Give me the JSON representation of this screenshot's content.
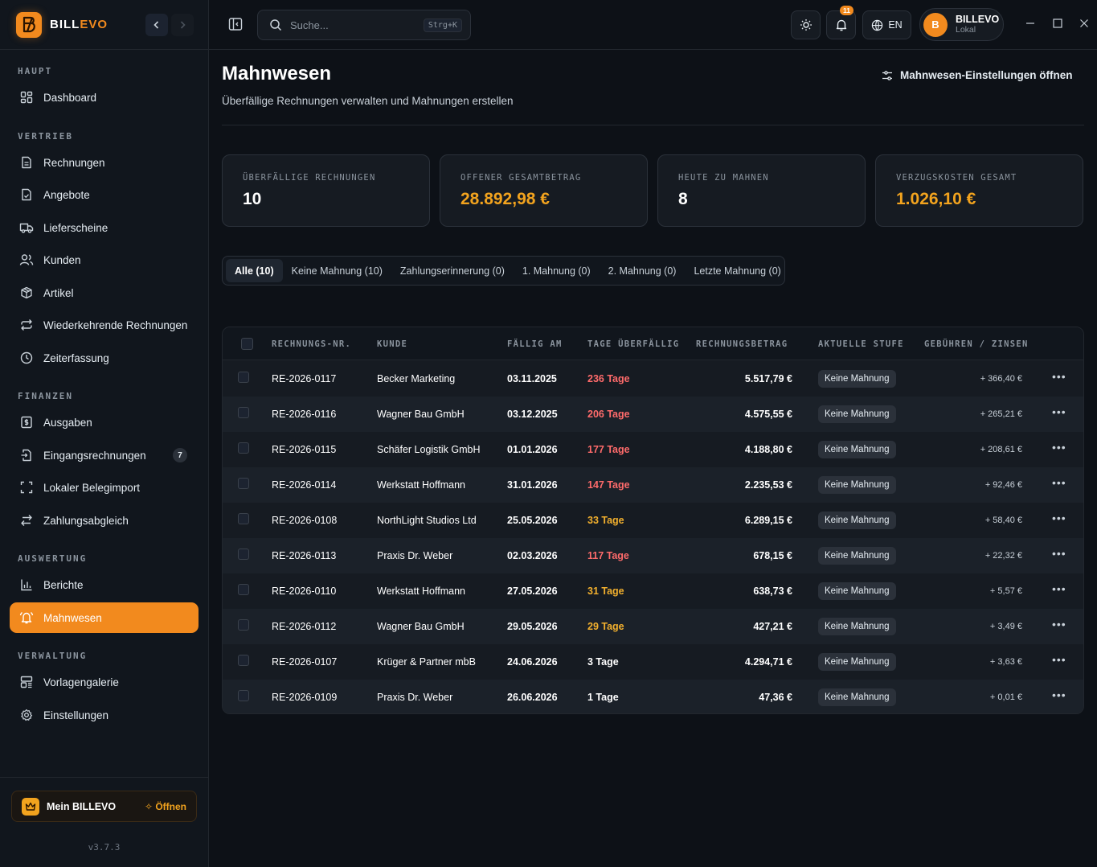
{
  "brand": {
    "name_part1": "BILL",
    "name_part2": "EVO"
  },
  "sidebar": {
    "sections": {
      "haupt": "HAUPT",
      "vertrieb": "VERTRIEB",
      "finanzen": "FINANZEN",
      "auswertung": "AUSWERTUNG",
      "verwaltung": "VERWALTUNG"
    },
    "items": {
      "dashboard": "Dashboard",
      "rechnungen": "Rechnungen",
      "angebote": "Angebote",
      "lieferscheine": "Lieferscheine",
      "kunden": "Kunden",
      "artikel": "Artikel",
      "wiederkehrend": "Wiederkehrende Rechnungen",
      "zeiterfassung": "Zeiterfassung",
      "ausgaben": "Ausgaben",
      "eingangsrechnungen": "Eingangsrechnungen",
      "eingangsrechnungen_count": "7",
      "belegimport": "Lokaler Belegimport",
      "zahlungsabgleich": "Zahlungsabgleich",
      "berichte": "Berichte",
      "mahnwesen": "Mahnwesen",
      "vorlagengalerie": "Vorlagengalerie",
      "einstellungen": "Einstellungen"
    },
    "mein": {
      "label": "Mein BILLEVO",
      "open": "Öffnen"
    },
    "version": "v3.7.3"
  },
  "header": {
    "search_placeholder": "Suche...",
    "search_shortcut": "Strg+K",
    "notifications_count": "11",
    "language": "EN",
    "user": {
      "initial": "B",
      "name": "BILLEVO",
      "sub": "Lokal"
    }
  },
  "page": {
    "title": "Mahnwesen",
    "subtitle": "Überfällige Rechnungen verwalten und Mahnungen erstellen",
    "settings_link": "Mahnwesen-Einstellungen öffnen"
  },
  "stats": [
    {
      "label": "ÜBERFÄLLIGE RECHNUNGEN",
      "value": "10"
    },
    {
      "label": "OFFENER GESAMTBETRAG",
      "value": "28.892,98 €"
    },
    {
      "label": "HEUTE ZU MAHNEN",
      "value": "8"
    },
    {
      "label": "VERZUGSKOSTEN GESAMT",
      "value": "1.026,10 €"
    }
  ],
  "tabs": [
    "Alle (10)",
    "Keine Mahnung (10)",
    "Zahlungserinnerung (0)",
    "1. Mahnung (0)",
    "2. Mahnung (0)",
    "Letzte Mahnung (0)"
  ],
  "table": {
    "headers": {
      "nr": "RECHNUNGS-NR.",
      "kunde": "KUNDE",
      "faellig": "FÄLLIG AM",
      "tage": "TAGE ÜBERFÄLLIG",
      "betrag": "RECHNUNGSBETRAG",
      "stufe": "AKTUELLE STUFE",
      "gebuehren": "GEBÜHREN / ZINSEN"
    },
    "rows": [
      {
        "nr": "RE-2026-0117",
        "kunde": "Becker Marketing",
        "faellig": "03.11.2025",
        "tage": "236 Tage",
        "betrag": "5.517,79 €",
        "stufe": "Keine Mahnung",
        "gebuehren": "+ 366,40 €"
      },
      {
        "nr": "RE-2026-0116",
        "kunde": "Wagner Bau GmbH",
        "faellig": "03.12.2025",
        "tage": "206 Tage",
        "betrag": "4.575,55 €",
        "stufe": "Keine Mahnung",
        "gebuehren": "+ 265,21 €"
      },
      {
        "nr": "RE-2026-0115",
        "kunde": "Schäfer Logistik GmbH",
        "faellig": "01.01.2026",
        "tage": "177 Tage",
        "betrag": "4.188,80 €",
        "stufe": "Keine Mahnung",
        "gebuehren": "+ 208,61 €"
      },
      {
        "nr": "RE-2026-0114",
        "kunde": "Werkstatt Hoffmann",
        "faellig": "31.01.2026",
        "tage": "147 Tage",
        "betrag": "2.235,53 €",
        "stufe": "Keine Mahnung",
        "gebuehren": "+ 92,46 €"
      },
      {
        "nr": "RE-2026-0108",
        "kunde": "NorthLight Studios Ltd",
        "faellig": "25.05.2026",
        "tage": "33 Tage",
        "betrag": "6.289,15 €",
        "stufe": "Keine Mahnung",
        "gebuehren": "+ 58,40 €"
      },
      {
        "nr": "RE-2026-0113",
        "kunde": "Praxis Dr. Weber",
        "faellig": "02.03.2026",
        "tage": "117 Tage",
        "betrag": "678,15 €",
        "stufe": "Keine Mahnung",
        "gebuehren": "+ 22,32 €"
      },
      {
        "nr": "RE-2026-0110",
        "kunde": "Werkstatt Hoffmann",
        "faellig": "27.05.2026",
        "tage": "31 Tage",
        "betrag": "638,73 €",
        "stufe": "Keine Mahnung",
        "gebuehren": "+ 5,57 €"
      },
      {
        "nr": "RE-2026-0112",
        "kunde": "Wagner Bau GmbH",
        "faellig": "29.05.2026",
        "tage": "29 Tage",
        "betrag": "427,21 €",
        "stufe": "Keine Mahnung",
        "gebuehren": "+ 3,49 €"
      },
      {
        "nr": "RE-2026-0107",
        "kunde": "Krüger & Partner mbB",
        "faellig": "24.06.2026",
        "tage": "3 Tage",
        "betrag": "4.294,71 €",
        "stufe": "Keine Mahnung",
        "gebuehren": "+ 3,63 €"
      },
      {
        "nr": "RE-2026-0109",
        "kunde": "Praxis Dr. Weber",
        "faellig": "26.06.2026",
        "tage": "1 Tage",
        "betrag": "47,36 €",
        "stufe": "Keine Mahnung",
        "gebuehren": "+ 0,01 €"
      }
    ]
  },
  "colors": {
    "accent": "#f28a1e",
    "overdue_high": "#ff6b6b",
    "overdue_mid": "#f2b02e",
    "background": "#0d1117"
  }
}
